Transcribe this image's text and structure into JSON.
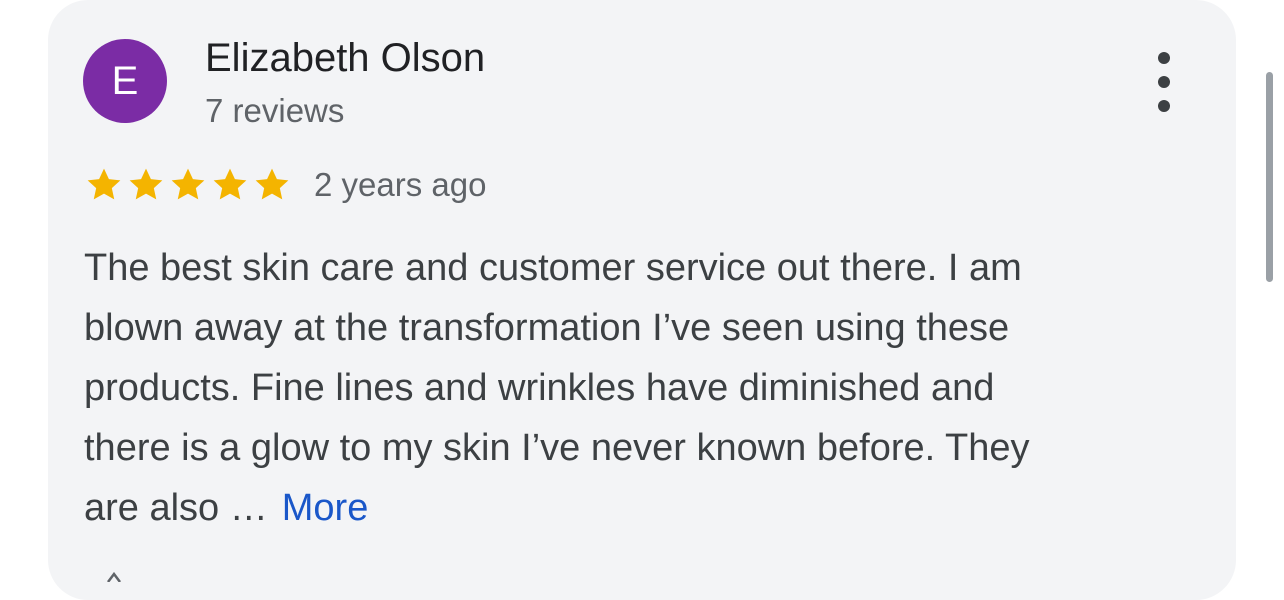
{
  "review": {
    "author_initial": "E",
    "author_name": "Elizabeth Olson",
    "author_review_count": "7 reviews",
    "rating": 5,
    "rating_max": 5,
    "time_ago": "2 years ago",
    "text_lines": [
      "The best skin care and customer service out there. I am",
      "blown away at the transformation I’ve seen using these",
      "products. Fine lines and wrinkles have diminished and",
      "there is a glow to my skin I’ve never known before. They",
      "are also …"
    ],
    "more_label": "More"
  },
  "icons": {
    "overflow_menu": "more-vert-icon",
    "star": "star-icon",
    "like": "thumb-up-icon"
  },
  "colors": {
    "avatar_bg": "#7b2ca5",
    "star": "#f4b400",
    "link": "#1a57c9",
    "card_bg": "#f3f4f6"
  }
}
